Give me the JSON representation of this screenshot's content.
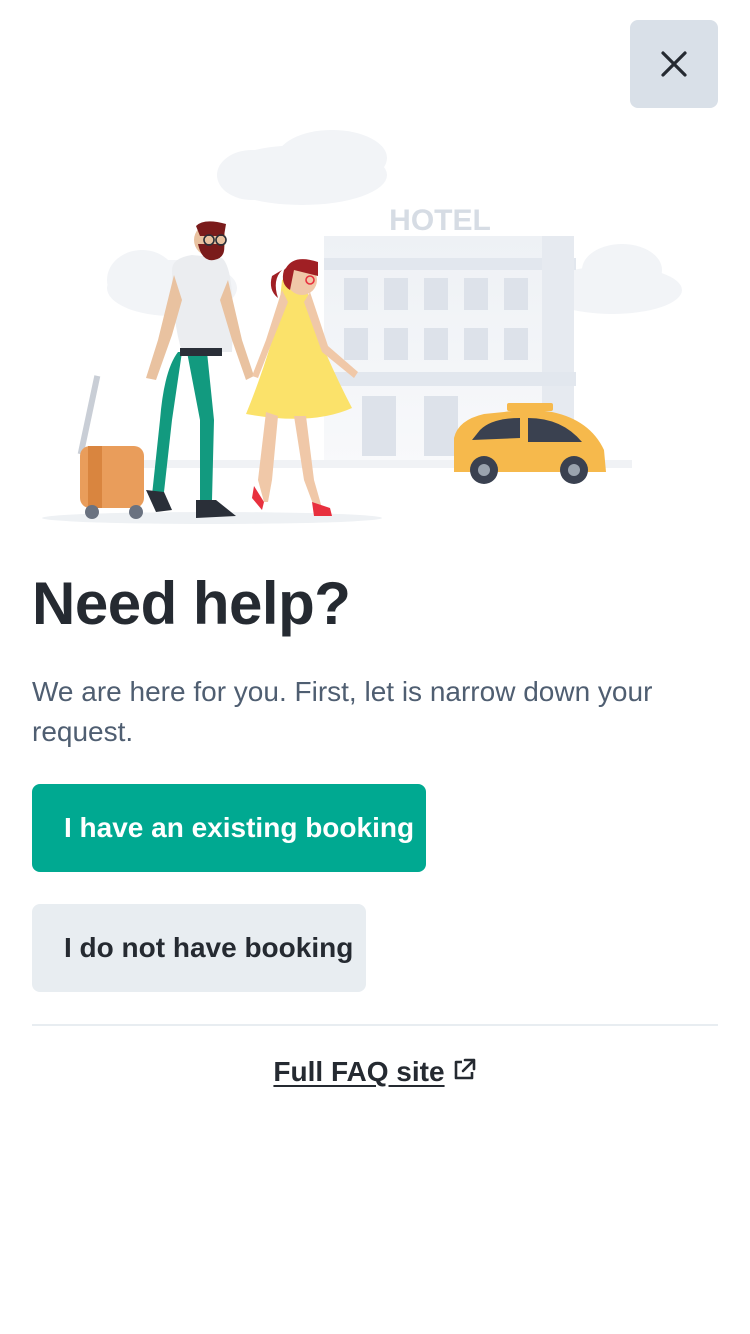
{
  "header": {
    "close_icon": "close-icon"
  },
  "illustration": {
    "sign_text": "HOTEL",
    "accent_colors": {
      "taxi": "#f6b94c",
      "dress": "#fbe26a",
      "pants": "#129a7f",
      "suitcase": "#e99d5b"
    }
  },
  "main": {
    "title": "Need help?",
    "description": "We are here for you. First, let is narrow down your request.",
    "primary_button_label": "I have an existing booking",
    "secondary_button_label": "I do not have booking"
  },
  "footer": {
    "faq_link_label": "Full FAQ site",
    "faq_link_icon": "external-link-icon"
  },
  "colors": {
    "primary": "#00a991",
    "secondary_bg": "#e8edf1",
    "title": "#252a31",
    "body_text": "#4f5e71",
    "close_bg": "#d9e0e8"
  }
}
